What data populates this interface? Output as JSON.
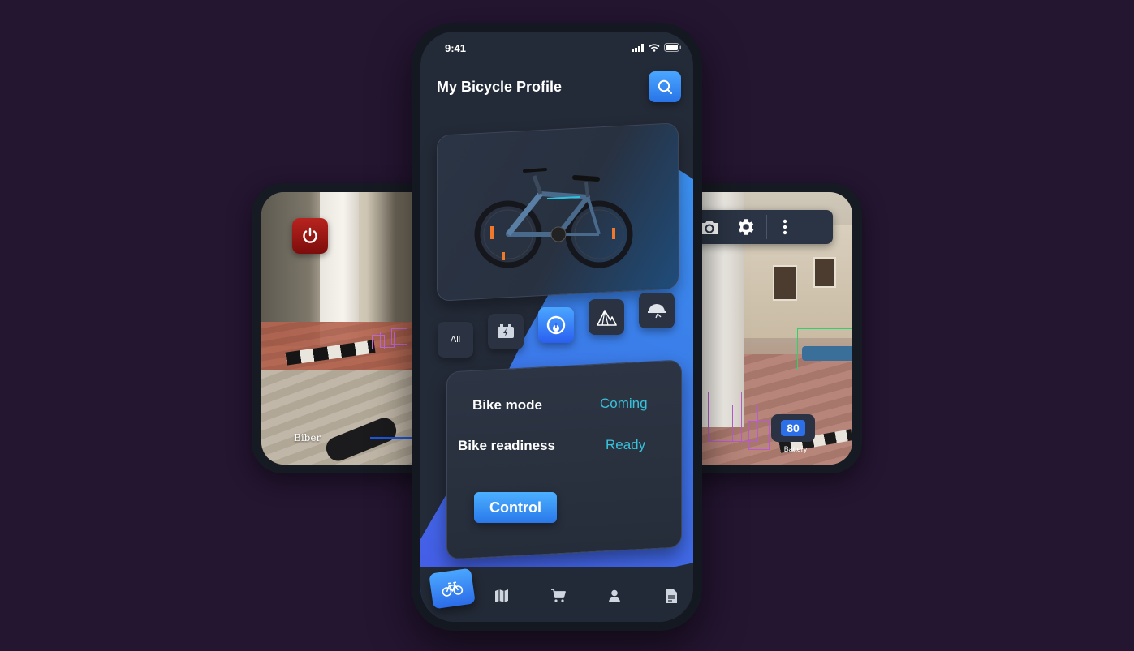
{
  "status_bar": {
    "time": "9:41"
  },
  "header": {
    "title": "My Bicycle Profile",
    "search_icon": "search-icon"
  },
  "categories": [
    {
      "label": "All",
      "icon": ""
    },
    {
      "label": "",
      "icon": "battery-icon"
    },
    {
      "label": "",
      "icon": "speedometer-icon"
    },
    {
      "label": "",
      "icon": "mountain-icon"
    },
    {
      "label": "",
      "icon": "helmet-icon"
    }
  ],
  "info": {
    "mode_label": "Bike mode",
    "mode_value": "Coming",
    "readiness_label": "Bike readiness",
    "readiness_value": "Ready",
    "control_label": "Control"
  },
  "tabbar": [
    "bicycle-icon",
    "map-icon",
    "cart-icon",
    "user-icon",
    "document-icon"
  ],
  "left_screen": {
    "brand_label": "Biber",
    "power_icon": "power-icon"
  },
  "right_screen": {
    "battery_value": "80",
    "battery_label": "Battery"
  },
  "colors": {
    "background": "#241531",
    "accent_blue": "#3b7de9",
    "status_teal": "#38c2dc",
    "power_red": "#a0181a"
  }
}
